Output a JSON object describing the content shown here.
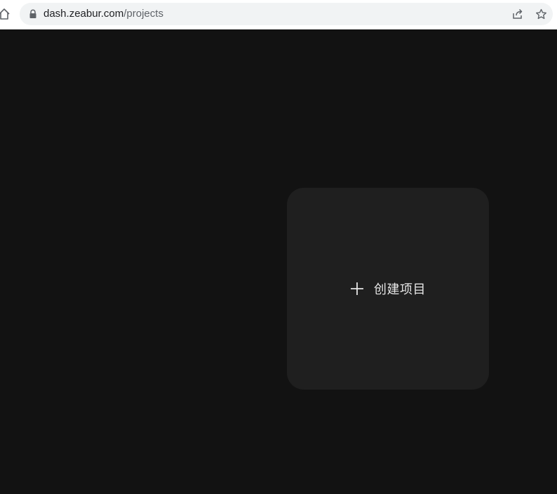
{
  "browser": {
    "url_host": "dash.zeabur.com",
    "url_path": "/projects",
    "icons": {
      "home": "home-icon",
      "lock": "lock-icon",
      "share": "share-icon",
      "bookmark": "star-icon"
    }
  },
  "main": {
    "create_project_label": "创建项目",
    "create_icon": "plus-icon"
  },
  "colors": {
    "page_background": "#121212",
    "card_background": "#1f1f1f",
    "card_text": "#e6e6e6",
    "omnibox_background": "#f1f3f4"
  }
}
